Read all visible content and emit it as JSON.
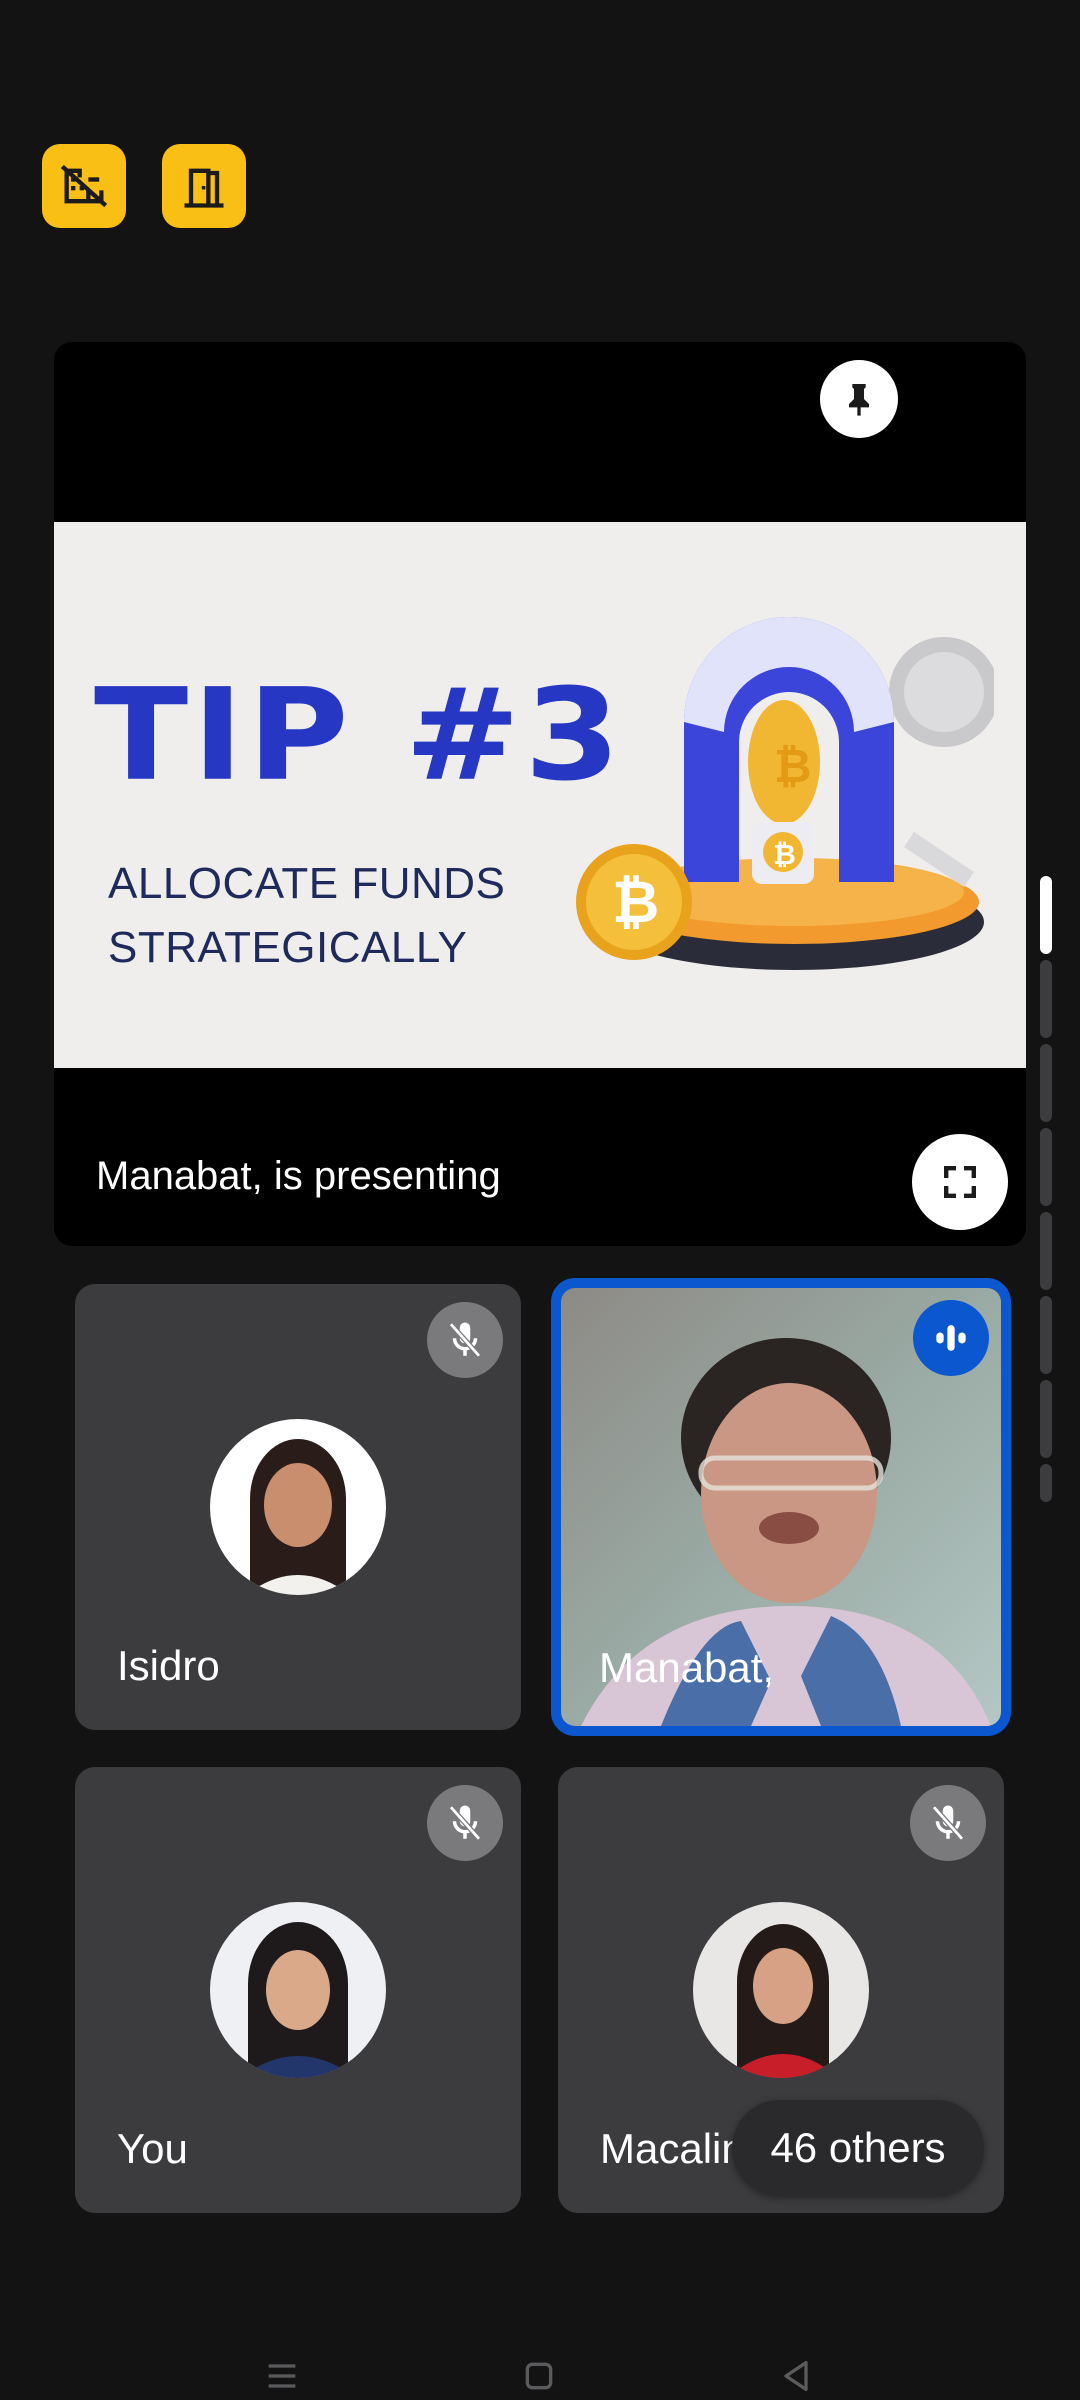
{
  "top_buttons": [
    {
      "icon": "domain-disabled-icon"
    },
    {
      "icon": "meeting-room-icon"
    }
  ],
  "presentation": {
    "slide_title": "TIP #3",
    "slide_subtitle_line1": "ALLOCATE FUNDS",
    "slide_subtitle_line2": "STRATEGICALLY",
    "status": "Manabat, is presenting",
    "pin_icon": "pin-icon",
    "fullscreen_icon": "fullscreen-icon"
  },
  "participants": [
    {
      "name": "Isidro",
      "muted": true,
      "speaking": false
    },
    {
      "name": "Manabat,",
      "muted": false,
      "speaking": true
    },
    {
      "name": "You",
      "muted": true,
      "speaking": false
    },
    {
      "name": "Macaline,",
      "muted": true,
      "speaking": false
    }
  ],
  "others_label": "46 others",
  "colors": {
    "background": "#131314",
    "tile": "#3c3c3f",
    "accent_yellow": "#f9bf15",
    "active_border": "#0b57d0",
    "slide_title": "#2637c3"
  }
}
